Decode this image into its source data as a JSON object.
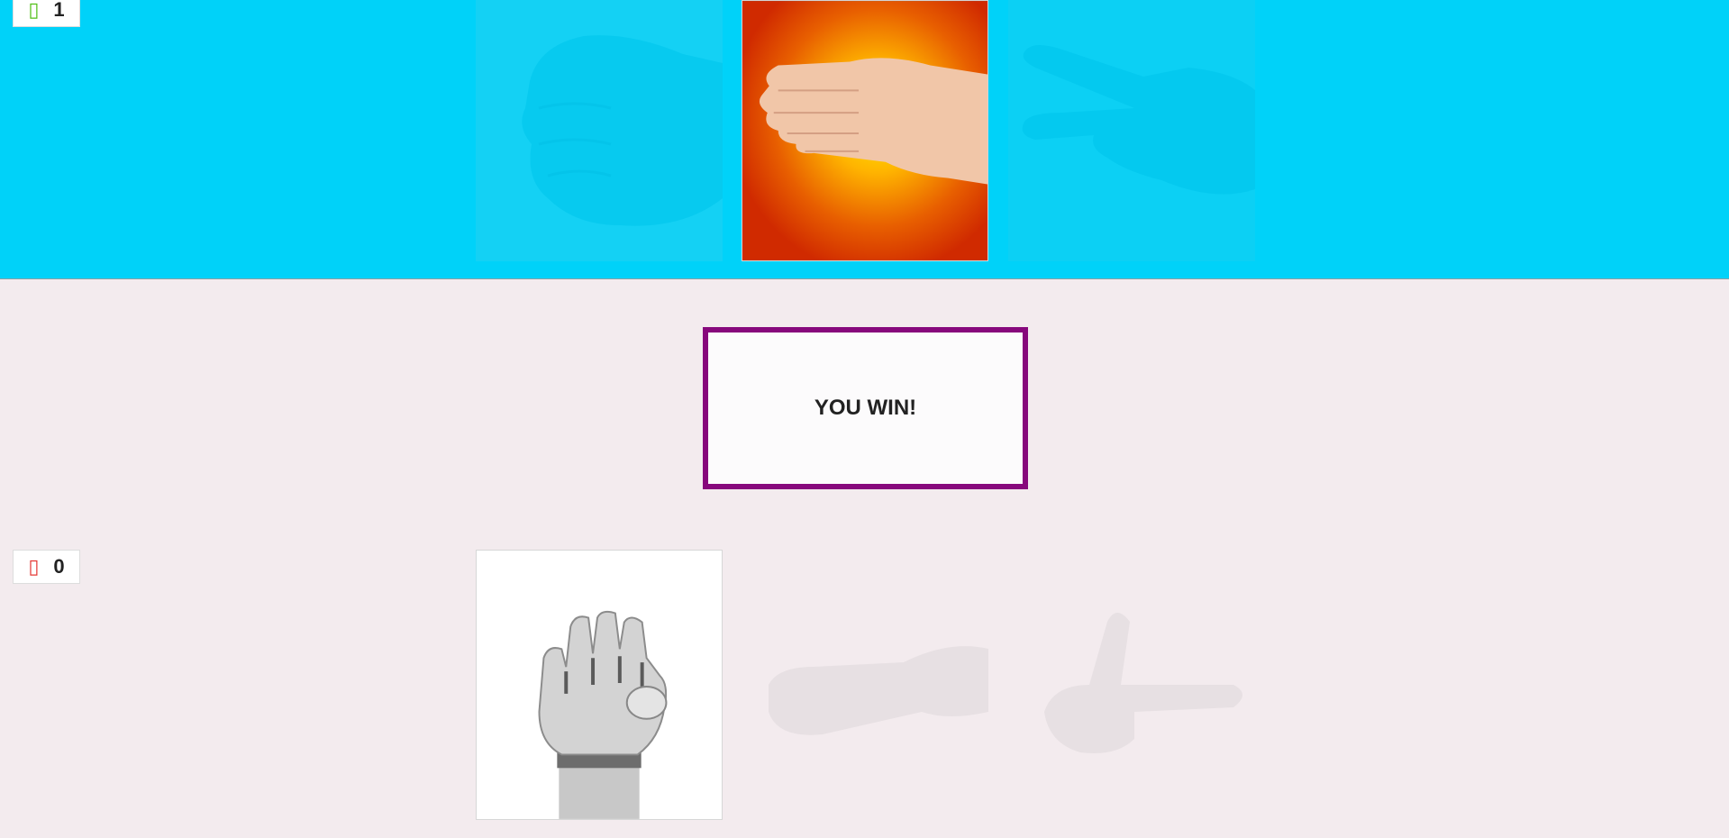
{
  "player": {
    "score": "1",
    "score_icon": "thumbs-up-icon",
    "score_icon_color": "#53c01a"
  },
  "computer": {
    "score": "0",
    "score_icon": "thumbs-down-icon",
    "score_icon_color": "#e53935"
  },
  "result": {
    "text": "YOU WIN!",
    "border_color": "#87087c"
  },
  "player_choices": [
    {
      "name": "rock",
      "icon": "human-fist-icon",
      "selected": false
    },
    {
      "name": "paper",
      "icon": "human-flat-hand-icon",
      "selected": true
    },
    {
      "name": "scissors",
      "icon": "human-scissors-hand-icon",
      "selected": false
    }
  ],
  "computer_choices": [
    {
      "name": "rock",
      "icon": "robot-fist-icon",
      "selected": true
    },
    {
      "name": "paper",
      "icon": "robot-flat-hand-icon",
      "selected": false
    },
    {
      "name": "scissors",
      "icon": "robot-scissors-hand-icon",
      "selected": false
    }
  ],
  "colors": {
    "top_background": "#00d2f9",
    "bottom_background": "#f3ebee"
  }
}
